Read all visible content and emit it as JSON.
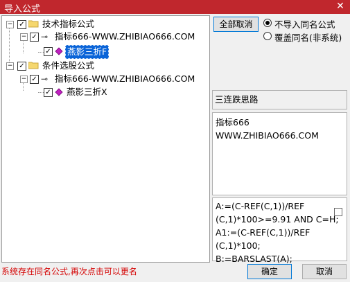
{
  "window": {
    "title": "导入公式",
    "close_glyph": "✕"
  },
  "tree": {
    "nodes": [
      {
        "label": "技术指标公式",
        "toggle": "−",
        "checked": true
      },
      {
        "label": "指标666-WWW.ZHIBIAO666.COM",
        "toggle": "−",
        "checked": true
      },
      {
        "label": "燕影三折F",
        "checked": true,
        "selected": true
      },
      {
        "label": "条件选股公式",
        "toggle": "−",
        "checked": true
      },
      {
        "label": "指标666-WWW.ZHIBIAO666.COM",
        "toggle": "−",
        "checked": true
      },
      {
        "label": "燕影三折X",
        "checked": true,
        "selected": false
      }
    ]
  },
  "options": {
    "cancel_all_label": "全部取消",
    "radio_no_import": "不导入同名公式",
    "radio_overwrite": "覆盖同名(非系统)",
    "selected_option": "不导入同名公式"
  },
  "panels": {
    "name": "三连跌思路",
    "desc_line1": "指标666",
    "desc_line2": "WWW.ZHIBIAO666.COM",
    "code_lines": [
      "A:=(C-REF(C,1))/REF",
      "(C,1)*100>=9.91  AND C=H;",
      "A1:=(C-REF(C,1))/REF",
      "(C,1)*100;",
      "B:=BARSLAST(A);"
    ]
  },
  "status_text": "系统存在同名公式,再次点击可以更名",
  "buttons": {
    "ok": "确定",
    "cancel": "取消"
  },
  "colors": {
    "titlebar": "#c0272d",
    "selection": "#0a64d8",
    "status_text": "#d40000"
  }
}
